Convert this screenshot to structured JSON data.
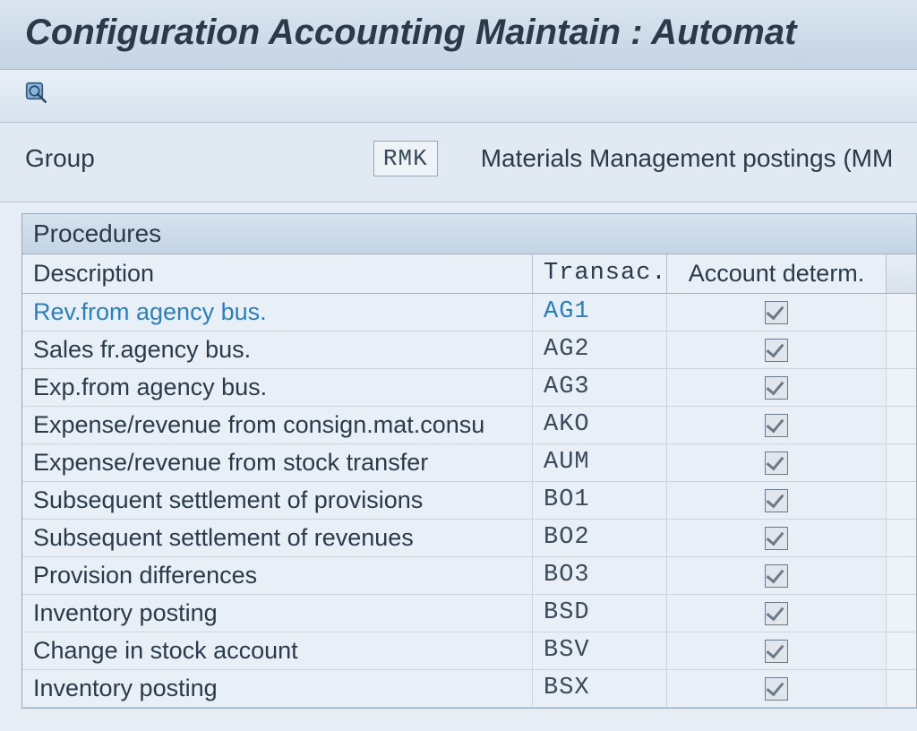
{
  "page_title": "Configuration Accounting Maintain : Automat",
  "group": {
    "label": "Group",
    "value": "RMK",
    "description": "Materials Management postings (MM"
  },
  "panel_title": "Procedures",
  "columns": {
    "description": "Description",
    "transaction": "Transac...",
    "account_determ": "Account determ."
  },
  "rows": [
    {
      "desc": "Rev.from agency bus.",
      "trans": "AG1",
      "acct": true,
      "selected": true
    },
    {
      "desc": "Sales fr.agency bus.",
      "trans": "AG2",
      "acct": true,
      "selected": false
    },
    {
      "desc": "Exp.from agency bus.",
      "trans": "AG3",
      "acct": true,
      "selected": false
    },
    {
      "desc": "Expense/revenue from consign.mat.consu",
      "trans": "AKO",
      "acct": true,
      "selected": false
    },
    {
      "desc": "Expense/revenue from stock transfer",
      "trans": "AUM",
      "acct": true,
      "selected": false
    },
    {
      "desc": "Subsequent settlement of provisions",
      "trans": "BO1",
      "acct": true,
      "selected": false
    },
    {
      "desc": "Subsequent settlement of revenues",
      "trans": "BO2",
      "acct": true,
      "selected": false
    },
    {
      "desc": "Provision differences",
      "trans": "BO3",
      "acct": true,
      "selected": false
    },
    {
      "desc": "Inventory posting",
      "trans": "BSD",
      "acct": true,
      "selected": false
    },
    {
      "desc": "Change in stock account",
      "trans": "BSV",
      "acct": true,
      "selected": false
    },
    {
      "desc": "Inventory posting",
      "trans": "BSX",
      "acct": true,
      "selected": false
    }
  ]
}
